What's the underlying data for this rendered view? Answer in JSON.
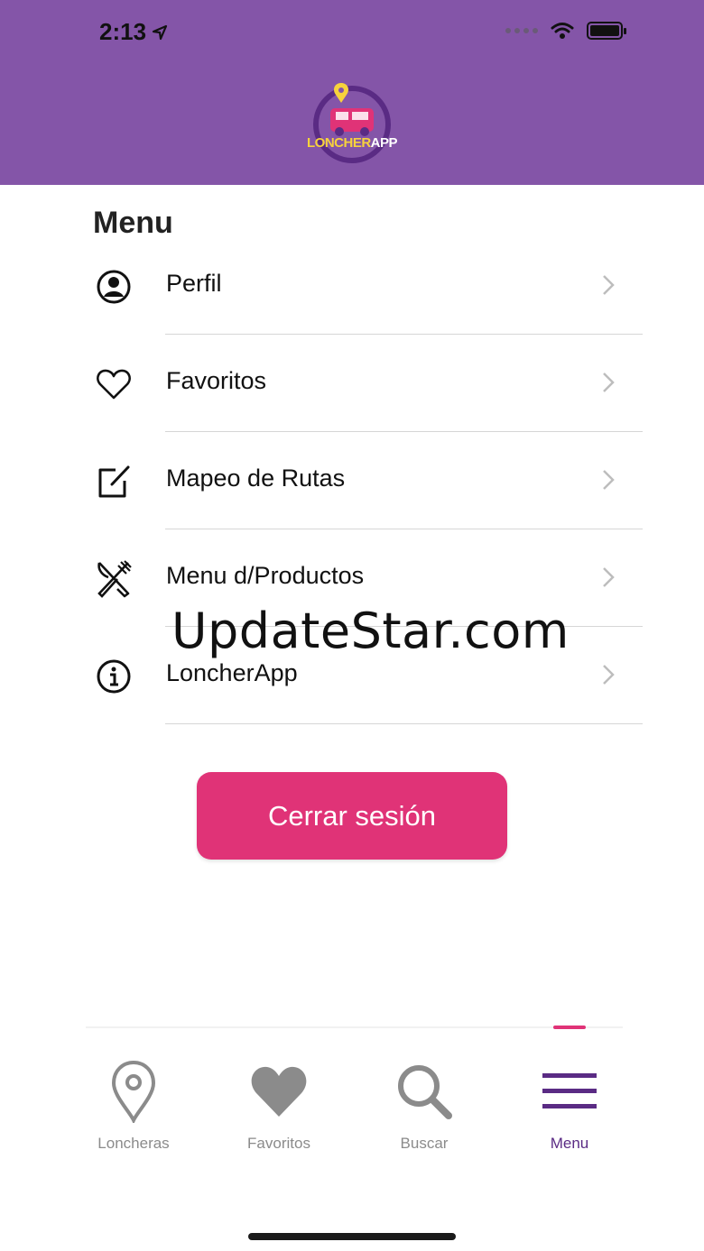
{
  "status_bar": {
    "time": "2:13"
  },
  "header": {
    "logo_text_1": "LONCHER",
    "logo_text_2": "APP"
  },
  "menu": {
    "title": "Menu",
    "items": [
      {
        "label": "Perfil",
        "icon": "user-circle-icon"
      },
      {
        "label": "Favoritos",
        "icon": "heart-outline-icon"
      },
      {
        "label": "Mapeo de Rutas",
        "icon": "edit-square-icon"
      },
      {
        "label": "Menu d/Productos",
        "icon": "fork-knife-icon"
      },
      {
        "label": "LoncherApp",
        "icon": "info-icon"
      }
    ]
  },
  "watermark": "UpdateStar.com",
  "logout_button": "Cerrar sesión",
  "tabbar": {
    "active": "Menu",
    "tabs": [
      {
        "label": "Loncheras",
        "icon": "map-pin-icon"
      },
      {
        "label": "Favoritos",
        "icon": "heart-icon"
      },
      {
        "label": "Buscar",
        "icon": "search-icon"
      },
      {
        "label": "Menu",
        "icon": "hamburger-menu-icon"
      }
    ]
  },
  "colors": {
    "header": "#8455a8",
    "accent": "#e03377",
    "active_tab": "#5a2b84",
    "inactive_tab": "#8b8b8b"
  }
}
